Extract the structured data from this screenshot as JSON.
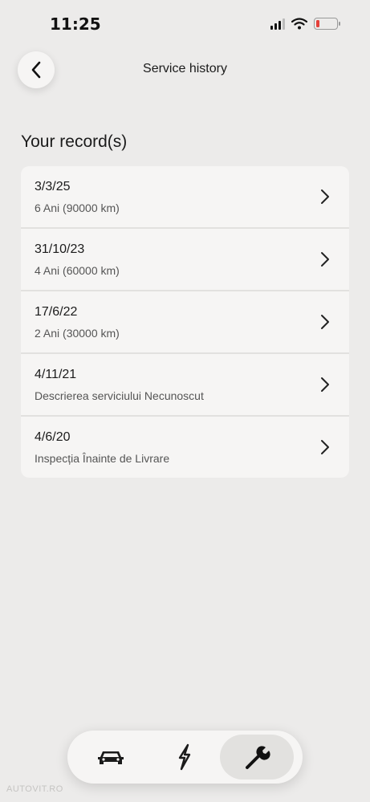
{
  "status_bar": {
    "time": "11:25"
  },
  "header": {
    "title": "Service history"
  },
  "section": {
    "title": "Your record(s)"
  },
  "records": [
    {
      "date": "3/3/25",
      "description": "6 Ani (90000 km)"
    },
    {
      "date": "31/10/23",
      "description": "4 Ani (60000 km)"
    },
    {
      "date": "17/6/22",
      "description": "2 Ani (30000 km)"
    },
    {
      "date": "4/11/21",
      "description": "Descrierea serviciului Necunoscut"
    },
    {
      "date": "4/6/20",
      "description": "Inspecția Înainte de Livrare"
    }
  ],
  "tabbar": {
    "tabs": [
      {
        "icon": "car-icon",
        "active": false
      },
      {
        "icon": "charge-icon",
        "active": false
      },
      {
        "icon": "wrench-icon",
        "active": true
      }
    ]
  },
  "watermark": "AUTOVIT.RO",
  "colors": {
    "background": "#ecebea",
    "card": "#f6f5f4",
    "battery_low": "#e5403a"
  }
}
